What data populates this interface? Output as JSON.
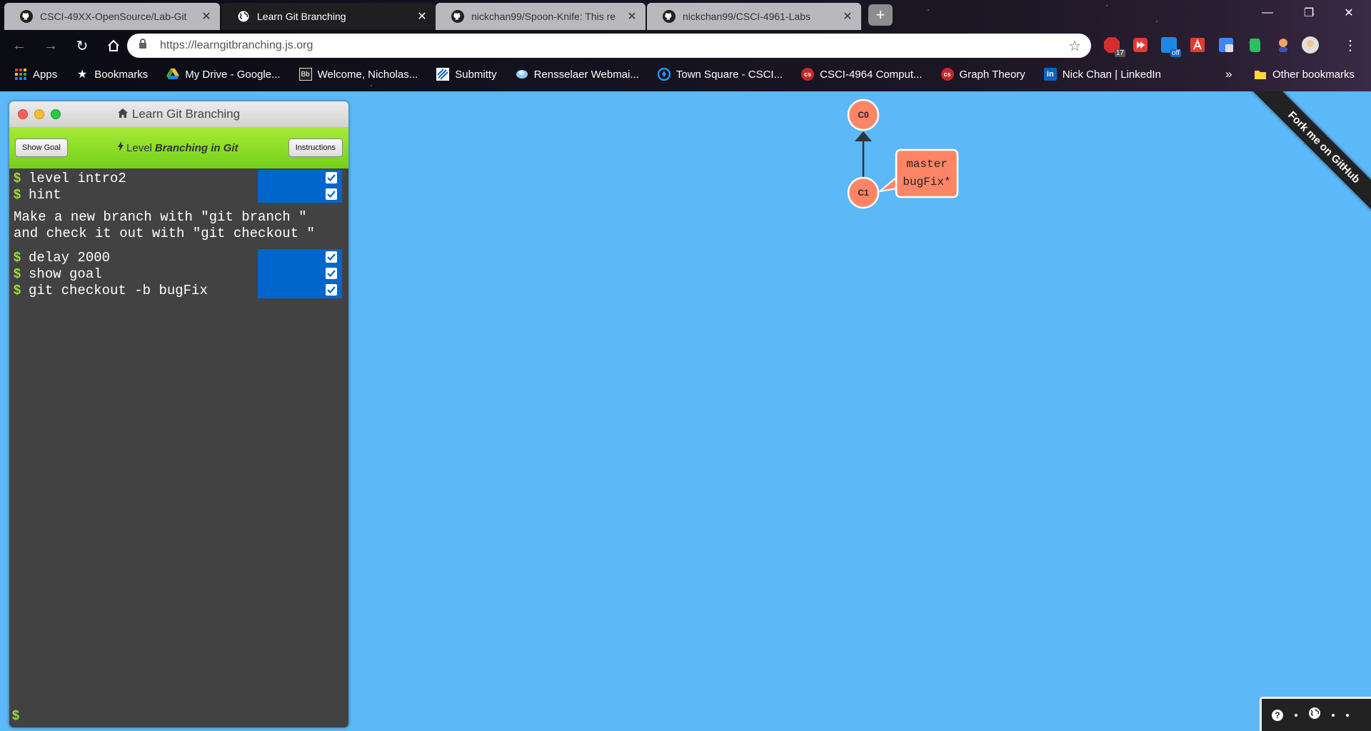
{
  "browser": {
    "tabs": [
      {
        "title": "CSCI-49XX-OpenSource/Lab-Git",
        "icon": "github-icon",
        "active": false
      },
      {
        "title": "Learn Git Branching",
        "icon": "globe-icon",
        "active": true
      },
      {
        "title": "nickchan99/Spoon-Knife: This re",
        "icon": "github-icon",
        "active": false
      },
      {
        "title": "nickchan99/CSCI-4961-Labs",
        "icon": "github-icon",
        "active": false
      }
    ],
    "url_host": "https://learngitbranching.js.org",
    "extension_badge": "17",
    "extension_off": "off",
    "bookmarks": [
      {
        "label": "Apps",
        "icon": "apps-grid-icon"
      },
      {
        "label": "Bookmarks",
        "icon": "star-icon"
      },
      {
        "label": "My Drive - Google...",
        "icon": "google-drive-icon"
      },
      {
        "label": "Welcome, Nicholas...",
        "icon": "blackboard-icon"
      },
      {
        "label": "Submitty",
        "icon": "submitty-icon"
      },
      {
        "label": "Rensselaer Webmai...",
        "icon": "webmail-icon"
      },
      {
        "label": "Town Square - CSCI...",
        "icon": "mattermost-icon"
      },
      {
        "label": "CSCI-4964 Comput...",
        "icon": "cs-icon"
      },
      {
        "label": "Graph Theory",
        "icon": "cs-icon"
      },
      {
        "label": "Nick Chan | LinkedIn",
        "icon": "linkedin-icon"
      }
    ],
    "overflow_label": "»",
    "other_bookmarks": "Other bookmarks"
  },
  "terminal": {
    "title": "Learn Git Branching",
    "show_goal": "Show Goal",
    "instructions": "Instructions",
    "level_prefix": "Level",
    "level_name": "Branching in Git",
    "commands_top": [
      "level intro2",
      "hint"
    ],
    "hint_lines": [
      "Make a new branch with \"git branch \"",
      "and check it out with \"git checkout \""
    ],
    "commands_bottom": [
      "delay 2000",
      "show goal",
      "git checkout -b bugFix"
    ],
    "prompt": "$"
  },
  "graph": {
    "commits": [
      "C0",
      "C1"
    ],
    "branch_labels": [
      "master",
      "bugFix*"
    ],
    "colors": {
      "commit": "#ff8566",
      "background": "#5cb8f7",
      "edge": "#333333"
    }
  },
  "ribbon": "Fork me on GitHub"
}
